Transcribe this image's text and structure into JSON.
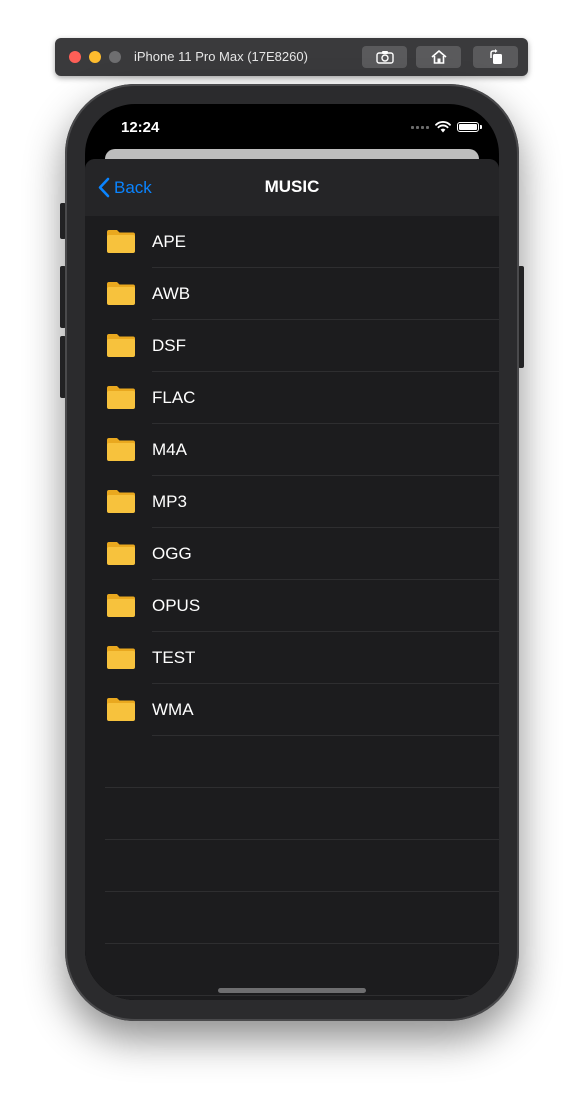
{
  "simulator": {
    "title": "iPhone 11 Pro Max (17E8260)",
    "buttons": [
      "screenshot-icon",
      "home-icon",
      "rotate-icon"
    ]
  },
  "status_bar": {
    "time": "12:24"
  },
  "nav": {
    "back_label": "Back",
    "title": "MUSIC"
  },
  "folders": [
    {
      "name": "APE"
    },
    {
      "name": "AWB"
    },
    {
      "name": "DSF"
    },
    {
      "name": "FLAC"
    },
    {
      "name": "M4A"
    },
    {
      "name": "MP3"
    },
    {
      "name": "OGG"
    },
    {
      "name": "OPUS"
    },
    {
      "name": "TEST"
    },
    {
      "name": "WMA"
    }
  ],
  "colors": {
    "accent": "#0a84ff",
    "folder": "#f7c23d",
    "folder_tab": "#e9a81f",
    "background": "#1c1c1e"
  }
}
